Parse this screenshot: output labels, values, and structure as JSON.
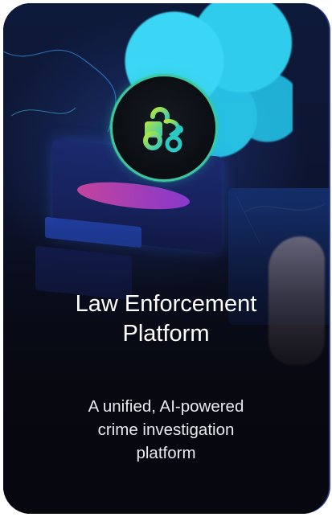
{
  "card": {
    "title_line1": "Law Enforcement",
    "title_line2": "Platform",
    "description_line1": "A unified, AI-powered",
    "description_line2": "crime investigation",
    "description_line3": "platform",
    "icon": "handcuffs-icon"
  },
  "colors": {
    "badge_ring": "#3cc7a0",
    "icon_gradient_start": "#b8e63a",
    "icon_gradient_end": "#2ec8c4",
    "card_background": "#07080f",
    "text": "#ffffff"
  }
}
